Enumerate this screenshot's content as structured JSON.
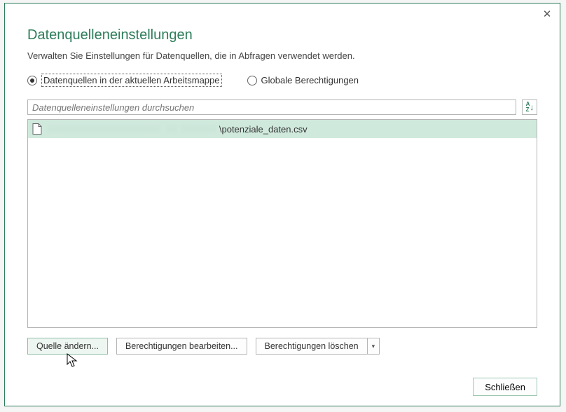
{
  "dialog": {
    "title": "Datenquelleneinstellungen",
    "subtitle": "Verwalten Sie Einstellungen für Datenquellen, die in Abfragen verwendet werden.",
    "close_label": "✕"
  },
  "scope": {
    "current_workbook": "Datenquellen in der aktuellen Arbeitsmappe",
    "global_permissions": "Globale Berechtigungen",
    "selected": "current_workbook"
  },
  "search": {
    "placeholder": "Datenquelleneinstellungen durchsuchen",
    "value": ""
  },
  "list": {
    "items": [
      {
        "visible_suffix": "\\potenziale_daten.csv"
      }
    ]
  },
  "actions": {
    "change_source": "Quelle ändern...",
    "edit_permissions": "Berechtigungen bearbeiten...",
    "clear_permissions": "Berechtigungen löschen"
  },
  "footer": {
    "close": "Schließen"
  }
}
